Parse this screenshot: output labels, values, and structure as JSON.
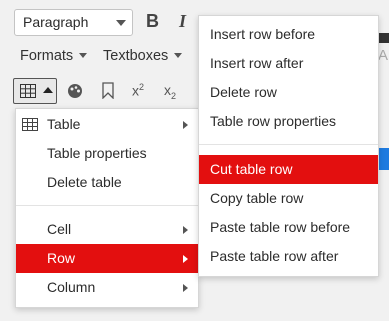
{
  "toolbar": {
    "block_format": "Paragraph",
    "bold_label": "B",
    "italic_label": "I",
    "formats_label": "Formats",
    "textboxes_label": "Textboxes",
    "partial_right_letter": "A",
    "icons": [
      "table-icon",
      "color-palette-icon",
      "bookmark-icon",
      "superscript-icon",
      "subscript-icon"
    ],
    "superscript_label": "x",
    "superscript_mark": "2",
    "subscript_label": "x",
    "subscript_mark": "2"
  },
  "table_menu": {
    "items": [
      {
        "label": "Table",
        "has_submenu": true,
        "icon": "table-icon"
      },
      {
        "label": "Table properties",
        "has_submenu": false
      },
      {
        "label": "Delete table",
        "has_submenu": false
      },
      {
        "label": "Cell",
        "has_submenu": true
      },
      {
        "label": "Row",
        "has_submenu": true,
        "active": true
      },
      {
        "label": "Column",
        "has_submenu": true
      }
    ]
  },
  "row_menu": {
    "items": [
      {
        "label": "Insert row before"
      },
      {
        "label": "Insert row after"
      },
      {
        "label": "Delete row"
      },
      {
        "label": "Table row properties"
      },
      {
        "label": "Cut table row",
        "active": true
      },
      {
        "label": "Copy table row"
      },
      {
        "label": "Paste table row before"
      },
      {
        "label": "Paste table row after"
      }
    ]
  },
  "colors": {
    "active_highlight": "#e30f0f",
    "accent_blue": "#1e7be0"
  }
}
